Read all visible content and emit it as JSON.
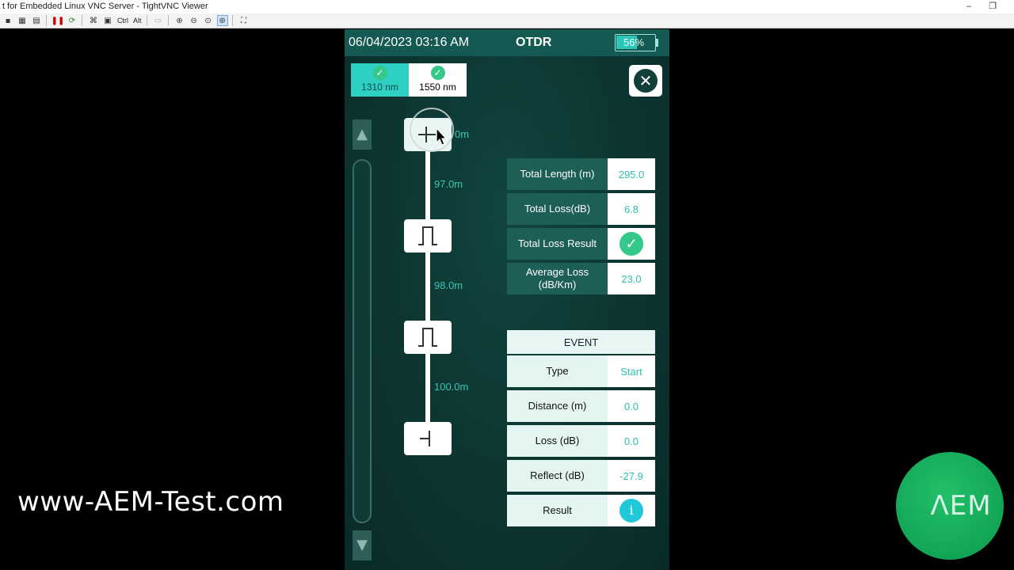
{
  "window": {
    "title": "t for Embedded Linux VNC Server - TightVNC Viewer",
    "minimize_label": "–",
    "restore_label": "❐"
  },
  "toolbar": {
    "ctrl_label": "Ctrl",
    "alt_label": "Alt",
    "icons": [
      "save-icon",
      "options-icon",
      "info-icon",
      "pause-icon",
      "refresh-icon",
      "ctrl-alt-del-icon",
      "ctrl-key",
      "alt-key",
      "clipboard-icon",
      "zoom-in-icon",
      "zoom-out-icon",
      "zoom-100-icon",
      "zoom-fit-icon",
      "fullscreen-icon"
    ]
  },
  "device": {
    "status": {
      "datetime": "06/04/2023 03:16 AM",
      "title": "OTDR",
      "battery": "56%",
      "battery_level": 0.56
    },
    "wavelengths": [
      {
        "label": "1310 nm",
        "selected": true
      },
      {
        "label": "1550 nm",
        "selected": false
      }
    ],
    "close_icon": "close-icon",
    "segments": [
      "97.0m",
      "98.0m",
      "100.0m"
    ],
    "first_node_label": "0m",
    "summary": [
      {
        "label": "Total Length (m)",
        "value": "295.0"
      },
      {
        "label": "Total Loss(dB)",
        "value": "6.8"
      },
      {
        "label": "Total Loss Result",
        "value": "✓"
      },
      {
        "label": "Average Loss (dB/Km)",
        "value": "23.0"
      }
    ],
    "event": {
      "heading": "EVENT",
      "rows": [
        {
          "label": "Type",
          "value": "Start"
        },
        {
          "label": "Distance (m)",
          "value": "0.0"
        },
        {
          "label": "Loss (dB)",
          "value": "0.0"
        },
        {
          "label": "Reflect (dB)",
          "value": "-27.9"
        },
        {
          "label": "Result",
          "value": "i"
        }
      ]
    }
  },
  "overlay": {
    "watermark": "www-AEM-Test.com",
    "logo": "ΛEM"
  },
  "colors": {
    "accent": "#2fd0c4",
    "panel": "#1d5e57",
    "background": "#0d3632",
    "ok": "#34c98a"
  }
}
